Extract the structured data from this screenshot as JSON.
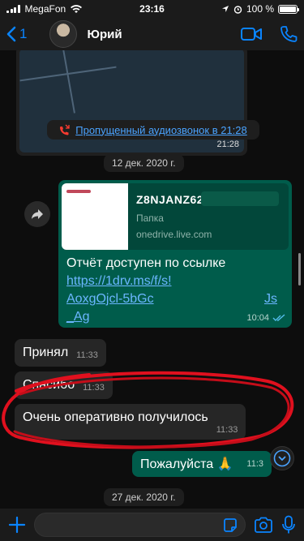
{
  "status_bar": {
    "carrier": "MegaFon",
    "time": "23:16",
    "battery": "100 %"
  },
  "header": {
    "back_count": "1",
    "contact_name": "Юрий"
  },
  "chat": {
    "map_message": {
      "time": "21:28"
    },
    "missed_call": {
      "text": "Пропущенный аудиозвонок в 21:28"
    },
    "date_1": "12 дек. 2020 г.",
    "link_message": {
      "preview_title": "Z8NJANZ62",
      "preview_subtitle": "Папка",
      "preview_domain": "onedrive.live.com",
      "text": "Отчёт доступен по ссылке",
      "link_line_1": "https://1drv.ms/f/s!",
      "link_line_2": "AoxgOjcl-5bGc",
      "link_line_2_tail": "Js",
      "link_line_3": "_Ag",
      "time": "10:04"
    },
    "incoming_messages": [
      {
        "text": "Принял",
        "time": "11:33"
      },
      {
        "text": "Спасибо",
        "time": "11:33"
      },
      {
        "text": "Очень оперативно получилось",
        "time": "11:33"
      }
    ],
    "outgoing_small": {
      "text": "Пожалуйста 🙏",
      "time": "11:3"
    },
    "date_2": "27 дек. 2020 г."
  },
  "colors": {
    "outgoing_bubble": "#005c4b",
    "incoming_bubble": "#262626",
    "accent": "#0a84ff",
    "missed_call_icon": "#ff3b30",
    "scribble": "#e0101e"
  }
}
